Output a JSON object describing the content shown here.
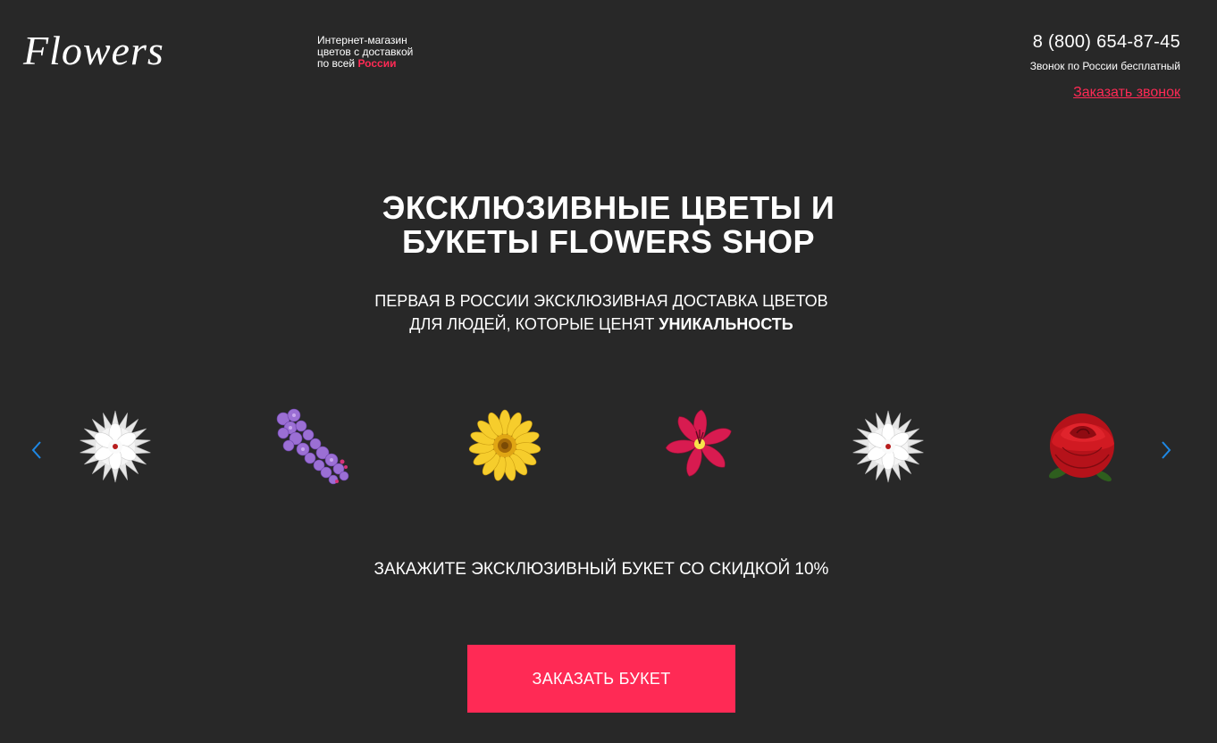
{
  "header": {
    "logo": "Flowers",
    "tagline_line1": "Интернет-магазин",
    "tagline_line2": "цветов с доставкой",
    "tagline_line3_prefix": "по всей ",
    "tagline_line3_accent": "России",
    "phone": "8 (800) 654-87-45",
    "phone_note": "Звонок по России бесплатный",
    "callback_link": "Заказать звонок"
  },
  "hero": {
    "title_line1": "ЭКСКЛЮЗИВНЫЕ ЦВЕТЫ И",
    "title_line2": "БУКЕТЫ FLOWERS SHOP",
    "subtitle_line1": "ПЕРВАЯ В РОССИИ ЭКСКЛЮЗИВНАЯ ДОСТАВКА ЦВЕТОВ",
    "subtitle_line2_prefix": "ДЛЯ ЛЮДЕЙ, КОТОРЫЕ ЦЕНЯТ ",
    "subtitle_line2_bold": "УНИКАЛЬНОСТЬ"
  },
  "carousel": {
    "prev_icon": "chevron-left-icon",
    "next_icon": "chevron-right-icon",
    "arrow_color": "#1e88e5",
    "items": [
      {
        "name": "white-dahlia",
        "color": "#f2f2f2"
      },
      {
        "name": "lilac",
        "color": "#9a6fd1"
      },
      {
        "name": "yellow-gerbera",
        "color": "#f5c928"
      },
      {
        "name": "pink-alstroemeria",
        "color": "#d81b4e"
      },
      {
        "name": "white-dahlia",
        "color": "#f2f2f2"
      },
      {
        "name": "red-rose",
        "color": "#c8121a"
      }
    ]
  },
  "promo": {
    "text": "ЗАКАЖИТЕ ЭКСКЛЮЗИВНЫЙ БУКЕТ СО СКИДКОЙ 10%",
    "button_label": "ЗАКАЗАТЬ БУКЕТ"
  },
  "colors": {
    "background": "#282828",
    "accent": "#ff2a55"
  }
}
